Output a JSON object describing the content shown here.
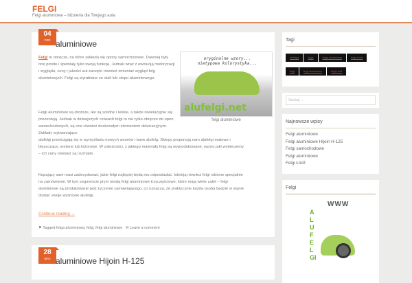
{
  "header": {
    "title": "FELGI",
    "tagline": "Felgi aluminiowe – biżuteria dla Twojego auta"
  },
  "post1": {
    "day": "04",
    "month": "CZE",
    "title": "aluminiowe",
    "p1_link": "Felgi",
    "p1": " to obręcze, na które zakłada się opony samochodowe. Dawniej były one proste i spełniały tyko swoją funkcję. Jednak wraz z ewolucją motoryzacji i wyglądu, ceny i jakości aut zaczęto również zmieniać wygląd felg aluminiowych. Felgi są wyrabiane ze stali lub stopu aluminiowego.",
    "image_top_text": "oryginalne wzory... nietypowa kolorystyka...",
    "image_logo": "alufelgi.net",
    "caption": "felgi aluminiowe",
    "p2a": "Felgi aluminiowe są droższe, ale są solidne i lekkie, a także rewelacyjnie się prezentują. Jednak w dzisiejszych czasach felgi to nie tylko obręcze do opon samochodowych, są one również doskonałym elementem dekoracyjnym. Zakłady wytwarzające",
    "p2b": "alufelgi prześcigają się w wymyślaniu nowych wzorów i barw alufelg. Sklepy proponują nam alufelgi matowe i błyszczące, srebrne lub kolorowe. W zależności, z jakiego materiału felgi są wyprodukowane, wzoru jaki wybierzemy – ich ceny również są rozmaite.",
    "p3": "Kupujący sam musi zadecydować, jakie felgi najlepiej będą mu odpowiadać. Istnieją również felgi robione specjalnie na zamówienie. W tym segmencie prym wiodą felgi aluminiowe trzyczęściowe, które mają wiele zalet – felgi aluminiowe są produkowane pod życzenie zamawiającego, co oznacza, że praktycznie każda osoba będzie w stanie dostać swoje wyśnione alufelgi.",
    "continue": "Continue reading →",
    "tagged": "Tagged felga aluminiowa, felgi, felgi aluminiowe",
    "comment": "Leave a comment"
  },
  "post2": {
    "day": "28",
    "month": "MAJ",
    "title": "aluminiowe Hijoin H-125"
  },
  "sidebar": {
    "tags_title": "Tagi",
    "tags": [
      "alufelga",
      "felga",
      "felga aluminiowa",
      "felga Łódź",
      "felgi",
      "felgi aluminiowe",
      "felgi Łódź"
    ],
    "search_placeholder": "Szukaj …",
    "recent_title": "Najnowsze wpisy",
    "recent": [
      "Felgi aluminiowe",
      "Felgi aluminiowe Hijoin H-125",
      "Felgi samochodowe",
      "Felgi aluminiowe",
      "Felgi Łódź"
    ],
    "felgi_title": "Felgi",
    "banner_text": "WWW ALUFELGI"
  }
}
